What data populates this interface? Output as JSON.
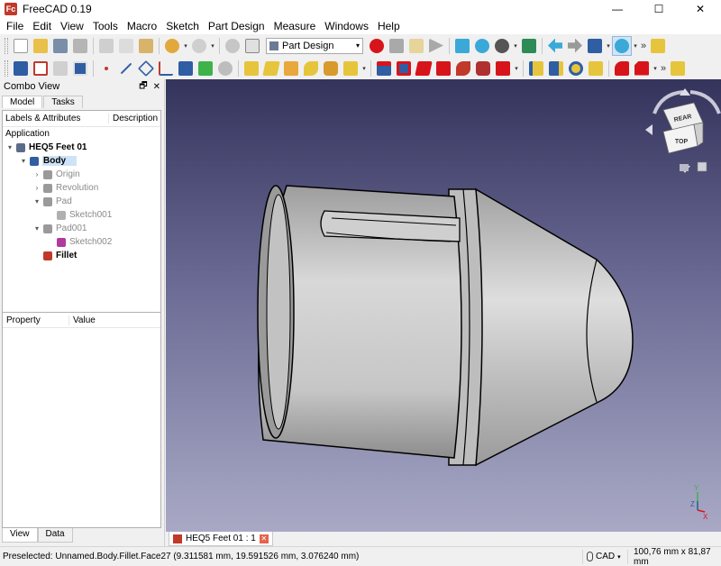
{
  "window": {
    "title": "FreeCAD 0.19",
    "icon_letters": "Fc",
    "minimize": "—",
    "maximize": "☐",
    "close": "✕"
  },
  "menu": [
    "File",
    "Edit",
    "View",
    "Tools",
    "Macro",
    "Sketch",
    "Part Design",
    "Measure",
    "Windows",
    "Help"
  ],
  "toolbar": {
    "workbench": "Part Design",
    "workbench_arrow": "▾",
    "more": "»"
  },
  "combo_view": {
    "title": "Combo View",
    "float_btn": "🗗",
    "close_btn": "✕",
    "tabs": [
      "Model",
      "Tasks"
    ],
    "tree_headers": {
      "labels": "Labels & Attributes",
      "description": "Description"
    },
    "application_label": "Application",
    "tree": [
      {
        "label": "HEQ5 Feet 01",
        "expander": "▾",
        "bold": true,
        "icon": "freecad-document-icon",
        "color": "#5b6b8a",
        "depth": 0
      },
      {
        "label": "Body",
        "expander": "▾",
        "bold": true,
        "selected": true,
        "icon": "body-icon",
        "color": "#2f5ea3",
        "depth": 1
      },
      {
        "label": "Origin",
        "expander": "›",
        "dim": true,
        "icon": "origin-icon",
        "color": "#9a9a9a",
        "depth": 2
      },
      {
        "label": "Revolution",
        "expander": "›",
        "dim": true,
        "icon": "revolution-icon",
        "color": "#9a9a9a",
        "depth": 2
      },
      {
        "label": "Pad",
        "expander": "▾",
        "dim": true,
        "icon": "pad-icon",
        "color": "#9a9a9a",
        "depth": 2
      },
      {
        "label": "Sketch001",
        "expander": "",
        "dim": true,
        "icon": "sketch-icon",
        "color": "#b0b0b0",
        "depth": 3
      },
      {
        "label": "Pad001",
        "expander": "▾",
        "dim": true,
        "icon": "pad-icon",
        "color": "#9a9a9a",
        "depth": 2
      },
      {
        "label": "Sketch002",
        "expander": "",
        "dim": true,
        "icon": "sketch-icon",
        "color": "#b03a9e",
        "depth": 3
      },
      {
        "label": "Fillet",
        "expander": "",
        "bold": true,
        "icon": "fillet-icon",
        "color": "#c0392b",
        "depth": 2
      }
    ],
    "property_headers": {
      "property": "Property",
      "value": "Value"
    },
    "property_tabs": [
      "View",
      "Data"
    ]
  },
  "nav_cube": {
    "rear": "REAR",
    "top": "TOP"
  },
  "axis": {
    "y": "Y",
    "z": "Z",
    "x": "X"
  },
  "document_tab": {
    "label": "HEQ5 Feet 01 : 1",
    "close": "✕"
  },
  "status": {
    "message": "Preselected: Unnamed.Body.Fillet.Face27 (9.311581 mm, 19.591526 mm, 3.076240 mm)",
    "nav_style": "CAD",
    "nav_arrow": "▾",
    "dimensions": "100,76 mm x 81,87 mm"
  },
  "colors": {
    "viewport_top": "#33335c",
    "viewport_bottom": "#a9a9c6",
    "selection": "#cde3f7",
    "record_macro": "#d8141b",
    "model_grey": "#c8c8c8"
  }
}
